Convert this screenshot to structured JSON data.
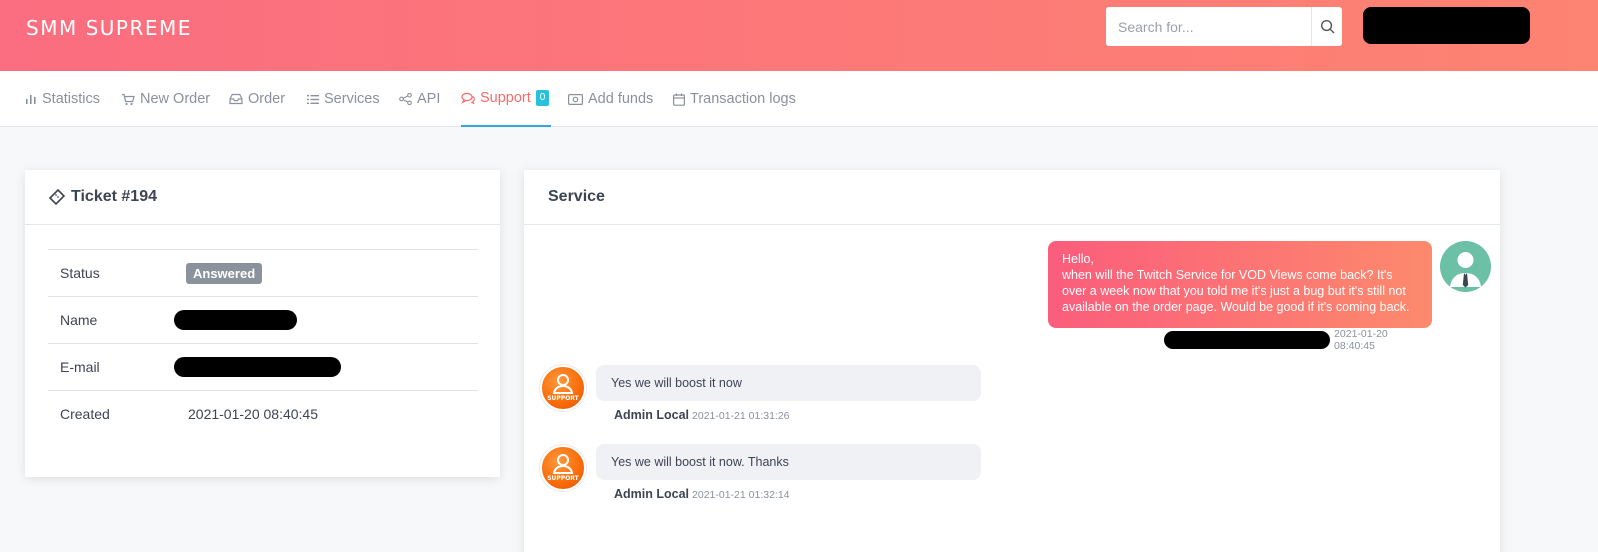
{
  "header": {
    "brand": "SMM SUPREME",
    "search_placeholder": "Search for..."
  },
  "nav": {
    "items": [
      {
        "label": "Statistics",
        "icon": "bar-chart-icon"
      },
      {
        "label": "New Order",
        "icon": "cart-icon"
      },
      {
        "label": "Order",
        "icon": "inbox-icon"
      },
      {
        "label": "Services",
        "icon": "list-icon"
      },
      {
        "label": "API",
        "icon": "share-icon"
      },
      {
        "label": "Support",
        "icon": "chat-icon",
        "badge": "0",
        "active": true
      },
      {
        "label": "Add funds",
        "icon": "money-icon"
      },
      {
        "label": "Transaction logs",
        "icon": "calendar-icon"
      }
    ]
  },
  "ticket": {
    "title": "Ticket #194",
    "rows": [
      {
        "label": "Status",
        "value": "Answered"
      },
      {
        "label": "Name",
        "value": ""
      },
      {
        "label": "E-mail",
        "value": ""
      },
      {
        "label": "Created",
        "value": "2021-01-20 08:40:45"
      }
    ]
  },
  "service": {
    "title": "Service",
    "messages": [
      {
        "direction": "out",
        "text": "Hello,\nwhen will the Twitch Service for VOD Views come back? It's over a week now that you told me it's just a bug but it's still not available on the order page. Would be good if it's coming back.",
        "time": "2021-01-20 08:40:45"
      },
      {
        "direction": "in",
        "text": "Yes we will boost it now",
        "author": "Admin Local",
        "time": "2021-01-21 01:31:26"
      },
      {
        "direction": "in",
        "text": "Yes we will boost it now. Thanks",
        "author": "Admin Local",
        "time": "2021-01-21 01:32:14"
      }
    ],
    "support_avatar_text": "SUPPORT"
  },
  "colors": {
    "header_gradient_start": "#fb6d80",
    "header_gradient_end": "#fd8372",
    "nav_active": "#f86c6b",
    "nav_active_underline": "#35a7d7",
    "badge": "#27c1dc",
    "status_badge": "#8a929c"
  }
}
